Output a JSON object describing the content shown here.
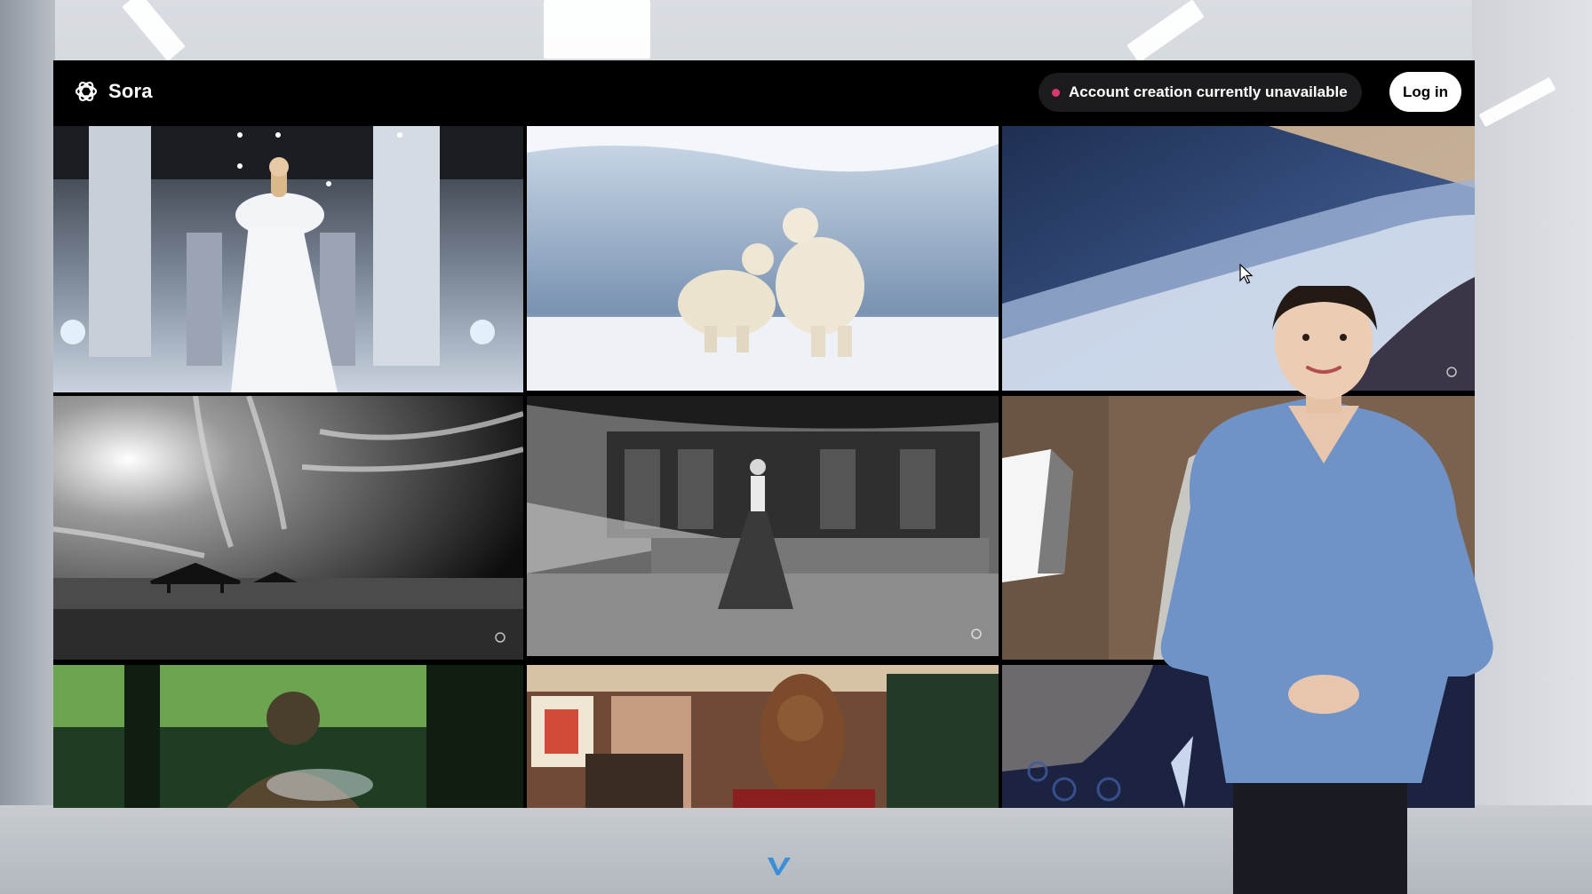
{
  "header": {
    "brand_name": "Sora",
    "notice_text": "Account creation currently unavailable",
    "login_label": "Log in"
  },
  "gallery": {
    "tiles": [
      {
        "subject": "runway-model"
      },
      {
        "subject": "polar-bears"
      },
      {
        "subject": "ocean-waves"
      },
      {
        "subject": "pavilion-sky"
      },
      {
        "subject": "hanbok-courtyard"
      },
      {
        "subject": "pelican-studio"
      },
      {
        "subject": "buddha-forest"
      },
      {
        "subject": "bigfoot-room"
      },
      {
        "subject": "dragon-fabric"
      }
    ]
  },
  "colors": {
    "notice_dot": "#e0366e",
    "topbar": "#000000",
    "notice_bg": "#1c1c1e"
  },
  "icons": {
    "brand": "openai-logo-icon",
    "cursor": "mouse-pointer-icon",
    "tile_badge": "sora-watermark-icon",
    "studio": "v-logo-icon"
  }
}
